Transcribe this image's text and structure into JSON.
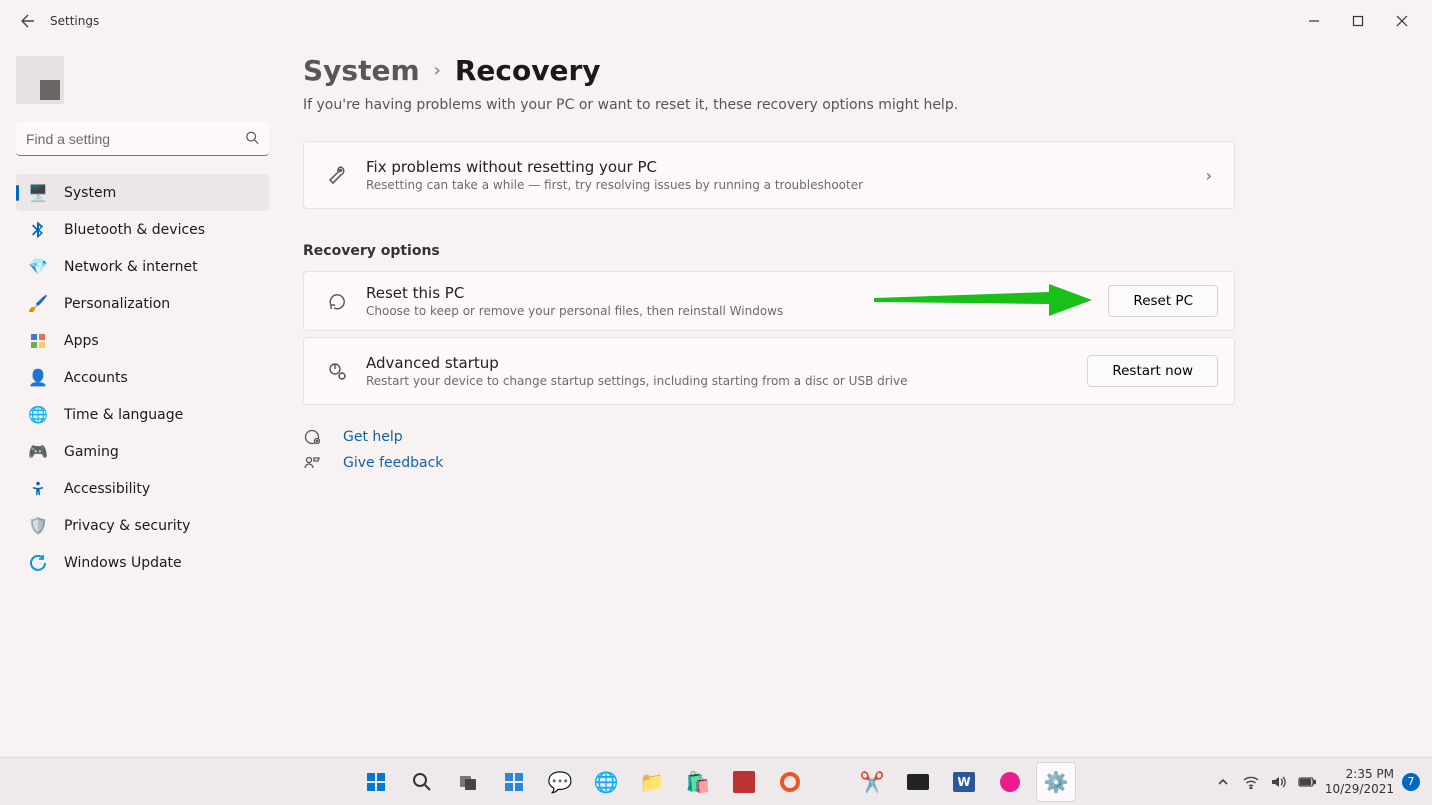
{
  "window": {
    "title": "Settings"
  },
  "search": {
    "placeholder": "Find a setting"
  },
  "sidebar": {
    "items": [
      {
        "label": "System"
      },
      {
        "label": "Bluetooth & devices"
      },
      {
        "label": "Network & internet"
      },
      {
        "label": "Personalization"
      },
      {
        "label": "Apps"
      },
      {
        "label": "Accounts"
      },
      {
        "label": "Time & language"
      },
      {
        "label": "Gaming"
      },
      {
        "label": "Accessibility"
      },
      {
        "label": "Privacy & security"
      },
      {
        "label": "Windows Update"
      }
    ]
  },
  "breadcrumb": {
    "parent": "System",
    "current": "Recovery"
  },
  "subtitle": "If you're having problems with your PC or want to reset it, these recovery options might help.",
  "troubleshoot": {
    "title": "Fix problems without resetting your PC",
    "desc": "Resetting can take a while — first, try resolving issues by running a troubleshooter"
  },
  "sections": {
    "recovery_options_title": "Recovery options"
  },
  "reset": {
    "title": "Reset this PC",
    "desc": "Choose to keep or remove your personal files, then reinstall Windows",
    "button": "Reset PC"
  },
  "advanced": {
    "title": "Advanced startup",
    "desc": "Restart your device to change startup settings, including starting from a disc or USB drive",
    "button": "Restart now"
  },
  "help": {
    "get_help": "Get help",
    "feedback": "Give feedback"
  },
  "taskbar": {
    "time": "2:35 PM",
    "date": "10/29/2021",
    "notif_count": "7"
  }
}
